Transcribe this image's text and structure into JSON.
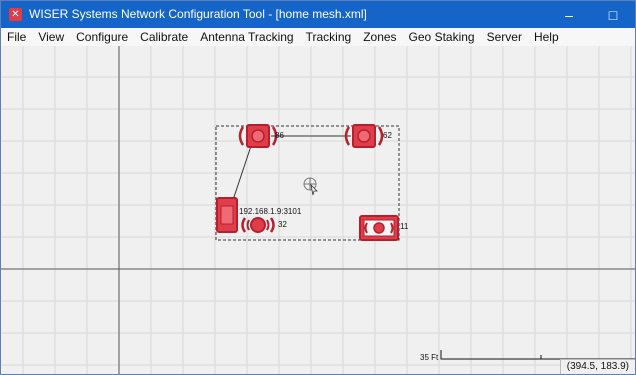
{
  "window": {
    "title": "WISER Systems Network Configuration Tool - [home mesh.xml]",
    "controls": {
      "minimize": "–",
      "maximize": "□",
      "close": "✕"
    },
    "app_icon": "wiser-logo-icon"
  },
  "menu": {
    "items": [
      "File",
      "View",
      "Configure",
      "Calibrate",
      "Antenna Tracking",
      "Tracking",
      "Zones",
      "Geo Staking",
      "Server",
      "Help"
    ]
  },
  "canvas": {
    "nodes": [
      {
        "id": "86",
        "label": "86"
      },
      {
        "id": "62",
        "label": "62"
      },
      {
        "id": "3101",
        "label": "192.168.1.9:3101"
      },
      {
        "id": "32",
        "label": "32"
      },
      {
        "id": "11",
        "label": "11"
      }
    ],
    "scale_label": "35 Ft",
    "colors": {
      "node": "#e03c4a",
      "node_dark": "#b5202e",
      "grid": "#d9d9d9",
      "axis": "#555555"
    }
  },
  "status": {
    "coords": "(394.5, 183.9)"
  }
}
